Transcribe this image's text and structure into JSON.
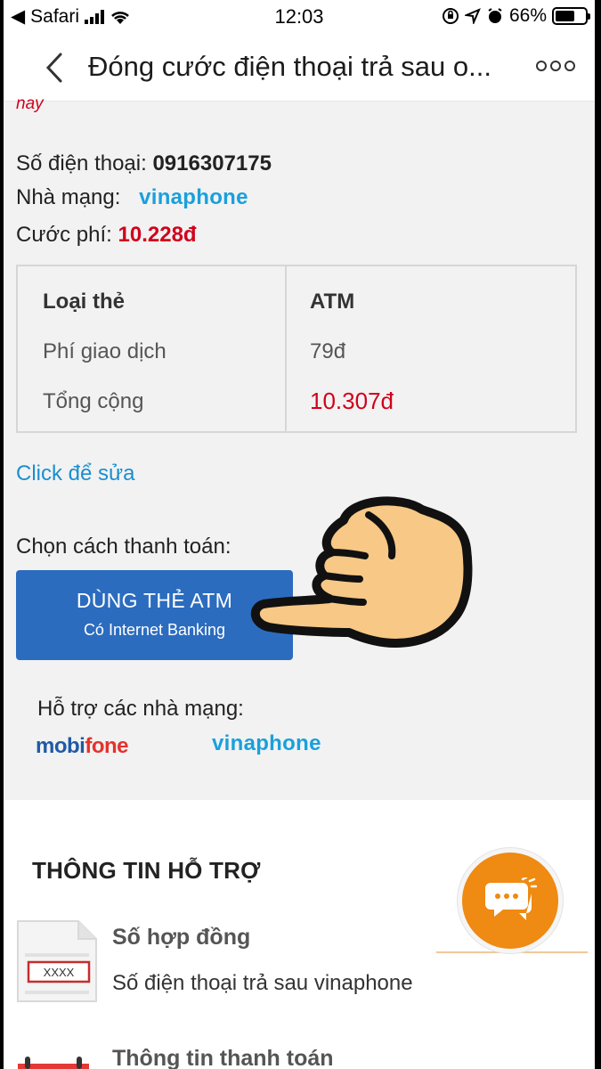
{
  "statusbar": {
    "back_app": "Safari",
    "time": "12:03",
    "battery": "66%"
  },
  "navbar": {
    "title": "Đóng cước điện thoại trả sau o..."
  },
  "bill": {
    "cut_text": "nay",
    "phone_label": "Số điện thoại:",
    "phone_value": "0916307175",
    "carrier_label": "Nhà mạng:",
    "carrier_value": "vinaphone",
    "fee_label": "Cước phí:",
    "fee_value": "10.228đ"
  },
  "fee_table": {
    "headers": [
      "Loại thẻ",
      "ATM"
    ],
    "rows": [
      {
        "label": "Phí giao dịch",
        "value": "79đ"
      },
      {
        "label": "Tổng cộng",
        "value": "10.307đ"
      }
    ]
  },
  "edit_link": "Click để sửa",
  "payment": {
    "label": "Chọn cách thanh toán:",
    "atm_button_line1": "DÙNG THẺ ATM",
    "atm_button_line2": "Có Internet Banking"
  },
  "supported": {
    "label": "Hỗ trợ các nhà mạng:",
    "mobifone_a": "mobi",
    "mobifone_b": "fone",
    "vinaphone": "vinaphone"
  },
  "support_info": {
    "title": "THÔNG TIN HỖ TRỢ",
    "items": [
      {
        "title": "Số hợp đồng",
        "subtitle": "Số điện thoại trả sau vinaphone",
        "icon_text": "XXXX"
      },
      {
        "title": "Thông tin thanh toán"
      }
    ]
  },
  "colors": {
    "accent_red": "#d0021b",
    "link_blue": "#1a8fd0",
    "button_blue": "#2b6cbf",
    "chat_orange": "#ef8a12",
    "vina_blue": "#1aa0dc"
  },
  "icons": [
    "back-chevron-icon",
    "more-dots-icon",
    "pointing-hand-icon",
    "document-icon",
    "calendar-icon",
    "chat-bubbles-icon"
  ]
}
